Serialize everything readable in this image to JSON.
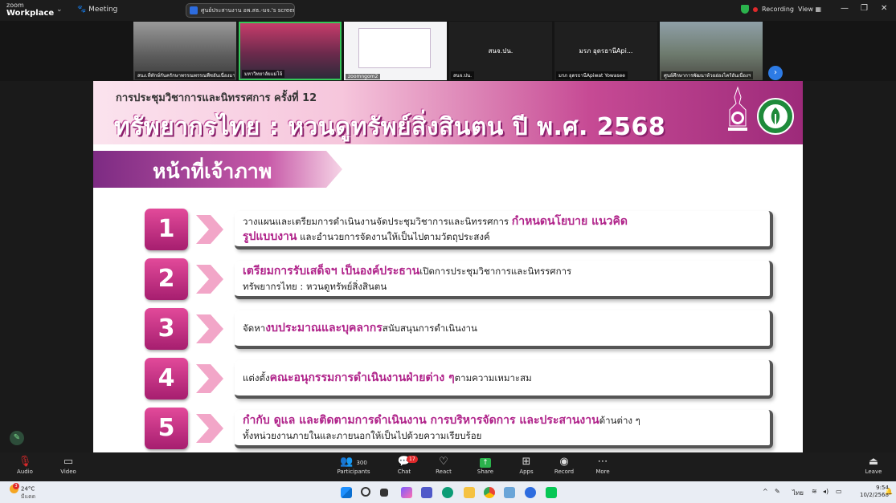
{
  "app": {
    "logo_top": "zoom",
    "logo_bottom": "Workplace",
    "meeting_label": "Meeting",
    "share_title": "ศูนย์ประสานงาน อพ.สธ.-มจ.'s screen",
    "recording_label": "Recording",
    "view_label": "View"
  },
  "participants_strip": [
    {
      "caption": "สนง.ที่ทักษ์กันครักษาพรรณพรรณพืชอันเนื่องมาจากพระราชดำริฯ"
    },
    {
      "caption": "มหาวิทยาลัยแม่โจ้"
    },
    {
      "caption": "zoomngom2"
    },
    {
      "name": "สนจ.ปน.",
      "caption": "สนจ.ปน."
    },
    {
      "name": "มรภ อุดรธานีApi...",
      "caption": "มรภ อุดรธานีApiwat Yowasee"
    },
    {
      "caption": "ศูนย์ศึกษาการพัฒนาห้วยฮ่องไคร้อันเนื่องฯ"
    }
  ],
  "slide": {
    "subtitle": "การประชุมวิชาการและนิทรรศการ ครั้งที่ 12",
    "title": "ทรัพยากรไทย : หวนดูทรัพย์สิ่งสินตน ปี พ.ศ. 2568",
    "section_heading": "หน้าที่เจ้าภาพ",
    "items": [
      {
        "num": "1",
        "pre": "วางแผนและเตรียมการดำเนินงานจัดประชุมวิชาการและนิทรรศการ ",
        "hl": "กำหนดนโยบาย แนวคิด",
        "hl2": "รูปแบบงาน",
        "post": " และอำนวยการจัดงานให้เป็นไปตามวัตถุประสงค์"
      },
      {
        "num": "2",
        "hl": "เตรียมการรับเสด็จฯ เป็นองค์ประธาน",
        "post": "เปิดการประชุมวิชาการและนิทรรศการ",
        "line2": "ทรัพยากรไทย : หวนดูทรัพย์สิ่งสินตน"
      },
      {
        "num": "3",
        "pre": "จัดหา",
        "hl": "งบประมาณและบุคลากร",
        "post": "สนับสนุนการดำเนินงาน"
      },
      {
        "num": "4",
        "pre": "แต่งตั้ง",
        "hl": "คณะอนุกรรมการดำเนินงานฝ่ายต่าง ๆ",
        "post": " ตามความเหมาะสม"
      },
      {
        "num": "5",
        "hl": "กำกับ ดูแล และติดตามการดำเนินงาน การบริหารจัดการ และประสานงาน",
        "post": "ด้านต่าง ๆ",
        "line2": "ทั้งหน่วยงานภายในและภายนอกให้เป็นไปด้วยความเรียบร้อย"
      }
    ]
  },
  "toolbar": {
    "audio": "Audio",
    "video": "Video",
    "participants_count": "300",
    "participants": "Participants",
    "chat": "Chat",
    "chat_badge": "17",
    "react": "React",
    "share": "Share",
    "apps": "Apps",
    "record": "Record",
    "more": "More",
    "leave": "Leave"
  },
  "taskbar": {
    "temp": "24°C",
    "weather_badge": "3",
    "weather_cond": "มีแดด",
    "lang": "ไทย",
    "time": "9:54",
    "date": "10/2/2568"
  }
}
